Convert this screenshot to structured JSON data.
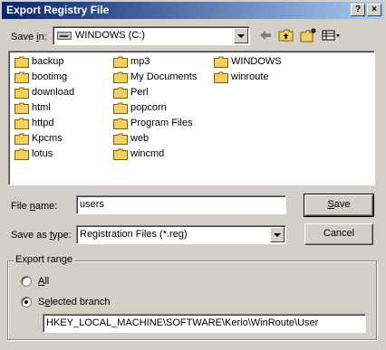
{
  "window": {
    "title": "Export Registry File",
    "help_glyph": "?",
    "close_glyph": "×"
  },
  "save_in": {
    "label_pre": "Save ",
    "label_key": "i",
    "label_post": "n:",
    "value": "WINDOWS (C:)"
  },
  "toolbar": {
    "back_icon": "back-arrow-icon",
    "up_icon": "up-folder-icon",
    "new_folder_icon": "new-folder-icon",
    "view_icon": "view-menu-icon"
  },
  "files": {
    "col1": [
      "backup",
      "bootimg",
      "download",
      "html",
      "httpd",
      "Kpcms",
      "lotus"
    ],
    "col2": [
      "mp3",
      "My Documents",
      "Perl",
      "popcorn",
      "Program Files",
      "web",
      "wincmd"
    ],
    "col3": [
      "WINDOWS",
      "winroute"
    ]
  },
  "file_name": {
    "label_pre": "File ",
    "label_key": "n",
    "label_post": "ame:",
    "value": "users"
  },
  "save_as_type": {
    "label_pre": "Save as ",
    "label_key": "t",
    "label_post": "ype:",
    "value": "Registration Files (*.reg)"
  },
  "buttons": {
    "save_key": "S",
    "save_rest": "ave",
    "cancel": "Cancel"
  },
  "export_range": {
    "title": "Export range",
    "all_key": "A",
    "all_rest": "ll",
    "selected_key": "e",
    "selected_pre": "S",
    "selected_post": "lected branch",
    "branch_path": "HKEY_LOCAL_MACHINE\\SOFTWARE\\Kerio\\WinRoute\\User"
  },
  "colors": {
    "titlebar_start": "#0a246a",
    "titlebar_end": "#a6caf0",
    "face": "#d4d0c8",
    "folder": "#f0d060"
  }
}
